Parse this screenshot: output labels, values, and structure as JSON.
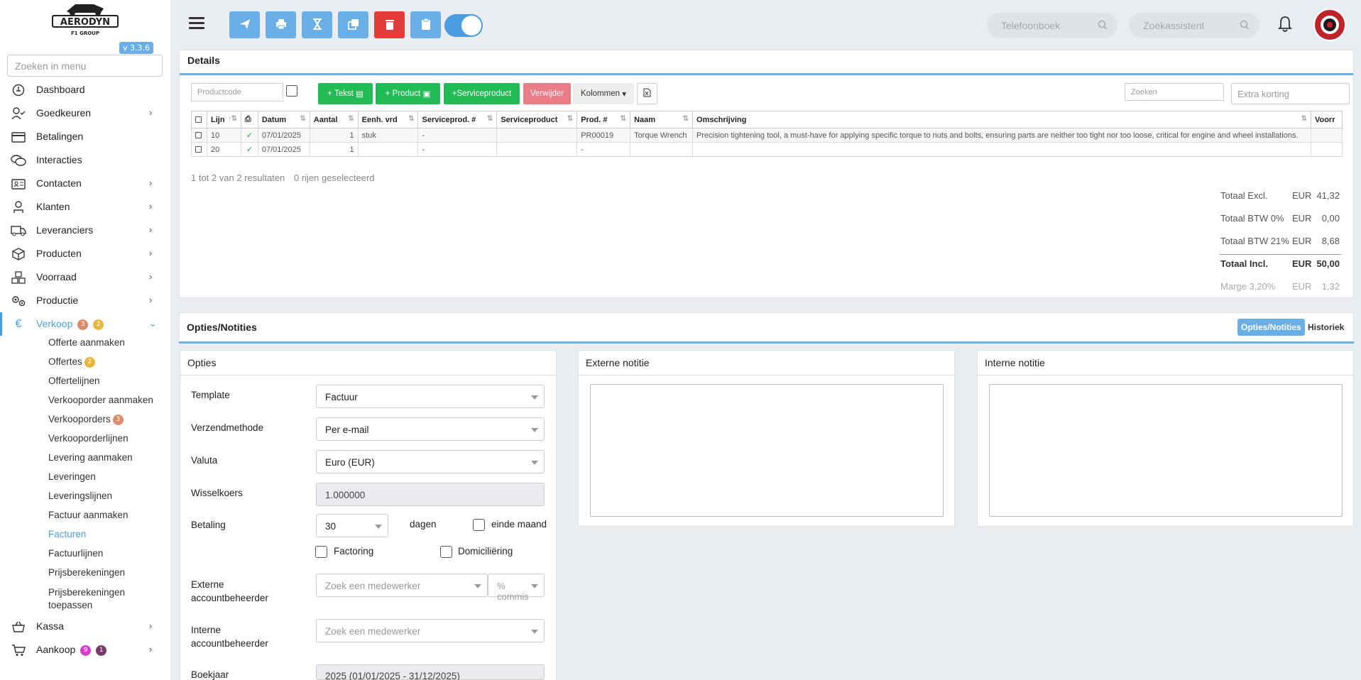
{
  "brand": {
    "logo_text": "AERODYN",
    "logo_sub": "F1 GROUP",
    "version": "v 3.3.6"
  },
  "sidebar": {
    "search_placeholder": "Zoeken in menu",
    "items": [
      {
        "label": "Dashboard",
        "icon": "dashboard-icon",
        "chevron": false
      },
      {
        "label": "Goedkeuren",
        "icon": "user-check-icon",
        "chevron": true
      },
      {
        "label": "Betalingen",
        "icon": "credit-card-icon",
        "chevron": false
      },
      {
        "label": "Interacties",
        "icon": "chat-icon",
        "chevron": false
      },
      {
        "label": "Contacten",
        "icon": "contact-card-icon",
        "chevron": true
      },
      {
        "label": "Klanten",
        "icon": "customer-icon",
        "chevron": true
      },
      {
        "label": "Leveranciers",
        "icon": "truck-icon",
        "chevron": true
      },
      {
        "label": "Producten",
        "icon": "box-icon",
        "chevron": true
      },
      {
        "label": "Voorraad",
        "icon": "stock-icon",
        "chevron": true
      },
      {
        "label": "Productie",
        "icon": "gears-icon",
        "chevron": true
      }
    ],
    "verkoop": {
      "label": "Verkoop",
      "icon": "euro-icon",
      "badge1": "3",
      "badge2": "2"
    },
    "sub_items": [
      {
        "label": "Offerte aanmaken"
      },
      {
        "label": "Offertes",
        "badge": "2"
      },
      {
        "label": "Offertelijnen"
      },
      {
        "label": "Verkooporder aanmaken"
      },
      {
        "label": "Verkooporders",
        "badge": "3"
      },
      {
        "label": "Verkooporderlijnen"
      },
      {
        "label": "Levering aanmaken"
      },
      {
        "label": "Leveringen"
      },
      {
        "label": "Leveringslijnen"
      },
      {
        "label": "Factuur aanmaken"
      },
      {
        "label": "Facturen",
        "active": true
      },
      {
        "label": "Factuurlijnen"
      },
      {
        "label": "Prijsberekeningen"
      },
      {
        "label": "Prijsberekeningen toepassen"
      }
    ],
    "kassa": {
      "label": "Kassa",
      "icon": "basket-icon"
    },
    "aankoop": {
      "label": "Aankoop",
      "icon": "cart-icon",
      "badge1": "9",
      "badge2": "1"
    }
  },
  "topbar": {
    "phonebook_placeholder": "Telefoonboek",
    "assistant_placeholder": "Zoekassistent",
    "colors": {
      "blue": "#6aaee8",
      "red": "#e53b3b",
      "accent": "#4a9ee0",
      "green": "#22bb55"
    }
  },
  "details": {
    "title": "Details",
    "productcode_placeholder": "Productcode",
    "btn_tekst": "Tekst",
    "btn_product": "Product",
    "btn_serviceproduct": "Serviceproduct",
    "btn_verwijder": "Verwijder",
    "btn_kolommen": "Kolommen",
    "search_placeholder": "Zoeken",
    "extra_korting_placeholder": "Extra korting",
    "columns": [
      "Lijn",
      "Datum",
      "Aantal",
      "Eenh. vrd",
      "Serviceprod. #",
      "Serviceproduct",
      "Prod. #",
      "Naam",
      "Omschrijving",
      "Voorr"
    ],
    "rows": [
      {
        "lijn": "10",
        "datum": "07/01/2025",
        "aantal": "1",
        "eenheid": "stuk",
        "serviceprod_nr": "-",
        "serviceproduct": "",
        "prod_nr": "PR00019",
        "naam": "Torque Wrench",
        "omschrijving": "Precision tightening tool, a must-have for applying specific torque to nuts and bolts, ensuring parts are neither too tight nor too loose, critical for engine and wheel installations.",
        "checked": true
      },
      {
        "lijn": "20",
        "datum": "07/01/2025",
        "aantal": "1",
        "eenheid": "",
        "serviceprod_nr": "-",
        "serviceproduct": "",
        "prod_nr": "-",
        "naam": "",
        "omschrijving": "",
        "checked": true
      }
    ],
    "result_text": "1 tot 2 van 2 resultaten",
    "selected_text": "0 rijen geselecteerd",
    "totals": [
      {
        "label": "Totaal Excl.",
        "cur": "EUR",
        "value": "41,32"
      },
      {
        "label": "Totaal BTW 0%",
        "cur": "EUR",
        "value": "0,00"
      },
      {
        "label": "Totaal BTW 21%",
        "cur": "EUR",
        "value": "8,68"
      },
      {
        "label": "Totaal Incl.",
        "cur": "EUR",
        "value": "50,00"
      },
      {
        "label": "Marge 3,20%",
        "cur": "EUR",
        "value": "1,32"
      }
    ]
  },
  "opties": {
    "title": "Opties/Notities",
    "tab_active": "Opties/Notities",
    "tab_other": "Historiek",
    "section_title": "Opties",
    "template_label": "Template",
    "template_value": "Factuur",
    "verzend_label": "Verzendmethode",
    "verzend_value": "Per e-mail",
    "valuta_label": "Valuta",
    "valuta_value": "Euro (EUR)",
    "wissel_label": "Wisselkoers",
    "wissel_value": "1.000000",
    "betaling_label": "Betaling",
    "betaling_value": "30",
    "dagen": "dagen",
    "einde_maand": "einde maand",
    "factoring": "Factoring",
    "domiciliering": "Domiciliëring",
    "ext_acc_label": "Externe accountbeheerder",
    "zoek_medewerker": "Zoek een medewerker",
    "commis_placeholder": "% commis",
    "int_acc_label": "Interne accountbeheerder",
    "boekjaar_label": "Boekjaar",
    "boekjaar_value": "2025 (01/01/2025 - 31/12/2025)"
  },
  "notes": {
    "external_title": "Externe notitie",
    "internal_title": "Interne notitie"
  }
}
